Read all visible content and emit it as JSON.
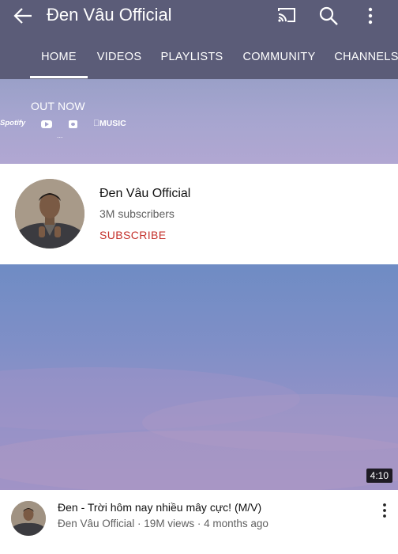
{
  "header": {
    "channel_title": "Đen Vâu Official",
    "background_color": "#5b5c78",
    "icons": [
      "back-arrow-icon",
      "cast-icon",
      "search-icon",
      "more-vertical-icon"
    ]
  },
  "tabs": [
    {
      "label": "HOME",
      "active": true
    },
    {
      "label": "VIDEOS",
      "active": false
    },
    {
      "label": "PLAYLISTS",
      "active": false
    },
    {
      "label": "COMMUNITY",
      "active": false
    },
    {
      "label": "CHANNELS",
      "active": false
    }
  ],
  "banner": {
    "headline": "OUT NOW",
    "platforms": [
      "Spotify",
      "YouTube",
      "Tidal",
      "MUSIC"
    ],
    "dots": "..."
  },
  "channel": {
    "name": "Đen Vâu Official",
    "subscribers": "3M subscribers",
    "subscribe_label": "SUBSCRIBE",
    "subscribe_color": "#c4302b"
  },
  "video": {
    "duration": "4:10",
    "title": "Đen - Trời hôm nay nhiều mây cực! (M/V)",
    "meta": "Đen Vâu Official · 19M views · 4 months ago"
  }
}
